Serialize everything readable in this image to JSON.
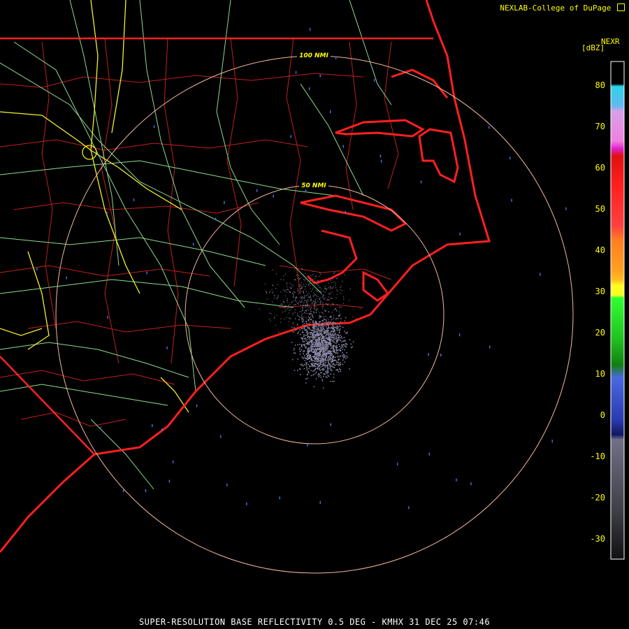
{
  "credit": "NEXLAB-College of DuPage",
  "credit_icon": "external-link-icon",
  "colorbar": {
    "title": "NEXR",
    "unit": "[dBZ]",
    "ticks": [
      "80",
      "70",
      "60",
      "50",
      "40",
      "30",
      "20",
      "10",
      "0",
      "-10",
      "-20",
      "-30"
    ]
  },
  "rings": [
    "100 NMI",
    "50 NMI"
  ],
  "footer": "SUPER-RESOLUTION BASE REFLECTIVITY 0.5 DEG - KMHX 31 DEC 25 07:46",
  "colors": {
    "state_border": "#ff2a2a",
    "county": "#cc2222",
    "roads": "#88dd88",
    "interstate": "#ffff33",
    "ring": "#f4b8a0",
    "echo": "#8a8aa8"
  }
}
